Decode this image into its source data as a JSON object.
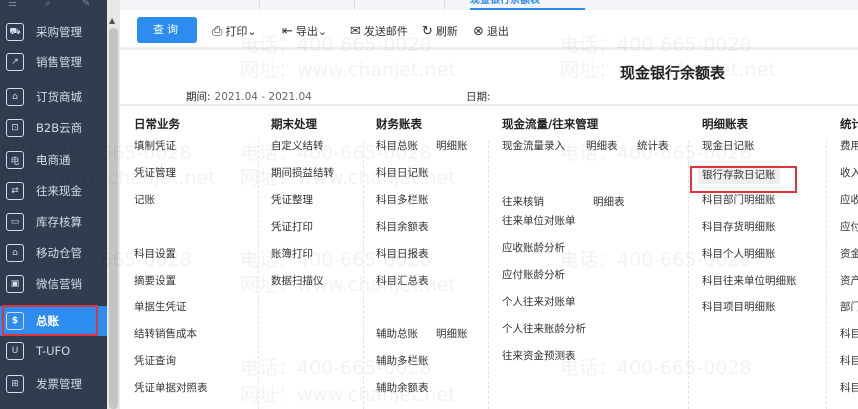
{
  "sidebar": {
    "items": [
      {
        "label": "采购管理",
        "icon": "cart-icon"
      },
      {
        "label": "销售管理",
        "icon": "chart-icon"
      },
      {
        "label": "订货商城",
        "icon": "store-icon"
      },
      {
        "label": "B2B云商",
        "icon": "bag-icon"
      },
      {
        "label": "电商通",
        "icon": "ecommerce-icon"
      },
      {
        "label": "往来现金",
        "icon": "exchange-icon"
      },
      {
        "label": "库存核算",
        "icon": "inventory-icon"
      },
      {
        "label": "移动仓管",
        "icon": "warehouse-icon"
      },
      {
        "label": "微信营销",
        "icon": "wechat-icon"
      },
      {
        "label": "总账",
        "icon": "ledger-icon",
        "active": true
      },
      {
        "label": "T-UFO",
        "icon": "ufo-icon"
      },
      {
        "label": "发票管理",
        "icon": "invoice-icon"
      }
    ]
  },
  "tabs": {
    "active": "现金银行余额表"
  },
  "toolbar": {
    "query": "查询",
    "print": "打印",
    "export": "导出",
    "email": "发送邮件",
    "refresh": "刷新",
    "exit": "退出"
  },
  "report": {
    "title": "现金银行余额表",
    "period_label": "期间:",
    "period_value": "2021.04 - 2021.04",
    "date_label": "日期:"
  },
  "menu": {
    "daily": {
      "title": "日常业务",
      "items": [
        "填制凭证",
        "凭证管理",
        "记账",
        "科目设置",
        "摘要设置",
        "单据生凭证",
        "结转销售成本",
        "凭证查询",
        "凭证单据对照表"
      ]
    },
    "period_end": {
      "title": "期末处理",
      "items": [
        "自定义结转",
        "期间损益结转",
        "凭证整理",
        "凭证打印",
        "账簿打印",
        "数据扫描仪"
      ]
    },
    "finance": {
      "title": "财务账表",
      "items": [
        "科目总账",
        "明细账",
        "科目日记账",
        "科目多栏账",
        "科目余额表",
        "科目日报表",
        "科目汇总表",
        "辅助总账",
        "明细账",
        "辅助多栏账",
        "辅助余额表"
      ]
    },
    "cashflow": {
      "title": "现金流量/往来管理",
      "items": [
        "现金流量录入",
        "明细表",
        "统计表",
        "往来核销",
        "明细表",
        "往来单位对账单",
        "应收账龄分析",
        "应付账龄分析",
        "个人往来对账单",
        "个人往来账龄分析",
        "往来资金预测表"
      ]
    },
    "detail": {
      "title": "明细账表",
      "items": [
        "现金日记账",
        "银行存款日记账",
        "科目部门明细账",
        "科目存货明细账",
        "科目个人明细账",
        "科目往来单位明细账",
        "科目项目明细账"
      ]
    },
    "stats": {
      "title": "统计",
      "items": [
        "费用",
        "收入",
        "应收",
        "应付",
        "资金",
        "资产",
        "部门",
        "科目",
        "科目",
        "科目"
      ]
    }
  },
  "watermark": {
    "phone": "电话：400-665-0028",
    "site": "网址：www.chanjet.net"
  },
  "colors": {
    "sidebar": "#2f3d4f",
    "accent": "#2d8cf0",
    "highlight": "#e0343c"
  }
}
